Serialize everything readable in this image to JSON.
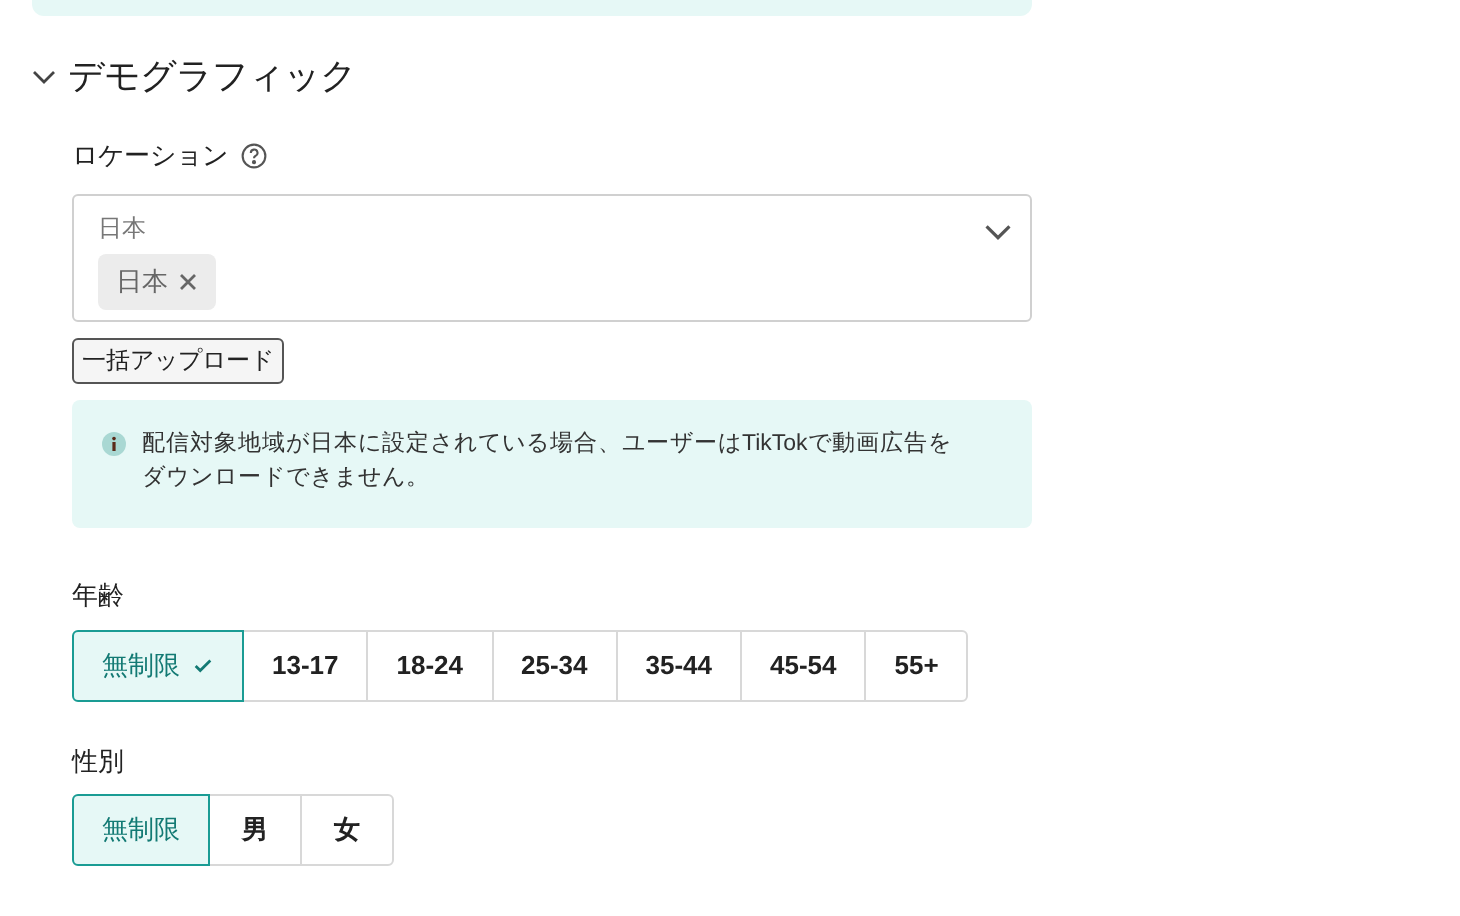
{
  "section": {
    "title": "デモグラフィック",
    "expanded": true
  },
  "location": {
    "label": "ロケーション",
    "field_label": "日本",
    "tags": [
      "日本"
    ],
    "button": "一括アップロード"
  },
  "notice": {
    "text": "配信対象地域が日本に設定されている場合、ユーザーはTikTokで動画広告をダウンロードできません。"
  },
  "groups": [
    {
      "label": "年齢",
      "check_on_selected": true,
      "options": [
        {
          "label": "無制限",
          "selected": true
        },
        {
          "label": "13-17",
          "selected": false
        },
        {
          "label": "18-24",
          "selected": false
        },
        {
          "label": "25-34",
          "selected": false
        },
        {
          "label": "35-44",
          "selected": false
        },
        {
          "label": "45-54",
          "selected": false
        },
        {
          "label": "55+",
          "selected": false
        }
      ]
    },
    {
      "label": "性別",
      "check_on_selected": false,
      "options": [
        {
          "label": "無制限",
          "selected": true
        },
        {
          "label": "男",
          "selected": false
        },
        {
          "label": "女",
          "selected": false
        }
      ]
    }
  ]
}
